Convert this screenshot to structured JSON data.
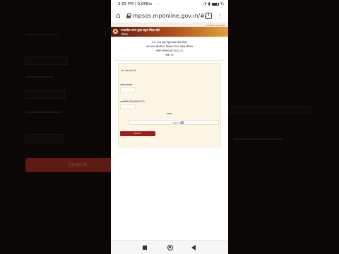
{
  "status_bar": {
    "time": "3:55 PM | 0.0KB/s",
    "extra": "···",
    "battery": "%"
  },
  "browser": {
    "url": "mpsos.mponline.gov.in/#/",
    "tab_count": "1"
  },
  "page": {
    "top_strip_text": "Contact us | Login",
    "header_line1": "मध्यप्रदेश राज्य मुक्त स्कूल शिक्षा बोर्ड",
    "header_line2": "भोपाल",
    "notice_lines": [
      "म.प्र. राज्य मुक्त स्कूल शिक्षा बोर्ड भोपाल",
      "रुक जाना नहीं योजना दिसम्बर 2021 परीक्षा परिणाम",
      "परीक्षा परिणाम वर्ष 2020-21",
      "कक्षा 10",
      ""
    ],
    "form": {
      "roll_label": "रोल नंबर दर्ज करें",
      "roll_placeholder": "",
      "appno_label": "आवेदन क्रमांक",
      "appno_placeholder": "",
      "dob_label": "जन्मतिथि (DD/MM/YYYY)",
      "dob_placeholder": "",
      "or_label": "अथवा",
      "captcha_label": "Captcha",
      "submit_label": "Search"
    }
  },
  "background": {
    "button_text": "Search"
  },
  "colors": {
    "header_dark": "#5a1a10",
    "header_light": "#e2a13a",
    "panel_bg": "#fdf6e4",
    "button_red": "#9b1f1f"
  },
  "icons": [
    "home-icon",
    "lock-icon",
    "tabs-icon",
    "menu-icon",
    "recents-icon",
    "home-nav-icon",
    "back-icon"
  ]
}
